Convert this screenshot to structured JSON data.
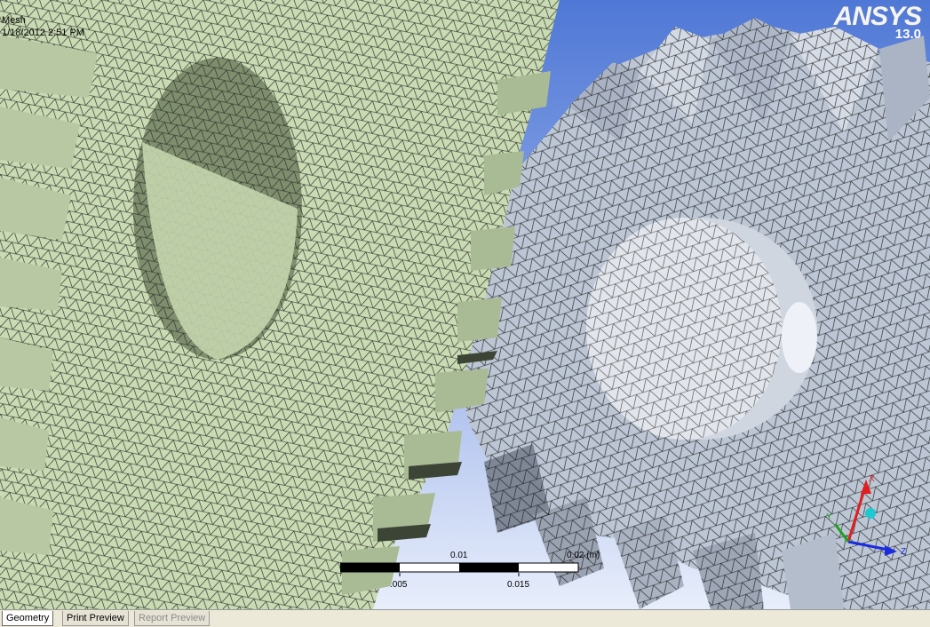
{
  "viewport": {
    "title": "Mesh",
    "timestamp": "1/18/2012 2:51 PM"
  },
  "logo": {
    "brand": "ANSYS",
    "version": "13.0"
  },
  "scale_bar": {
    "top_labels": [
      "0.01",
      "0.02 (m)"
    ],
    "bottom_labels": [
      ".005",
      "0.015"
    ]
  },
  "triad": {
    "x_label": "X",
    "y_label": "Y",
    "z_label": "Z"
  },
  "tabs": [
    {
      "label": "Geometry",
      "active": true
    },
    {
      "label": "Print Preview",
      "active": false
    },
    {
      "label": "Report Preview",
      "active": false,
      "disabled": true
    }
  ],
  "colors": {
    "left_gear": "#c9dbb3",
    "right_gear": "#c0c9d6",
    "background_top": "#4f78d6",
    "background_bottom": "#e8eefb",
    "mesh_lines": "#1a1a1a"
  }
}
